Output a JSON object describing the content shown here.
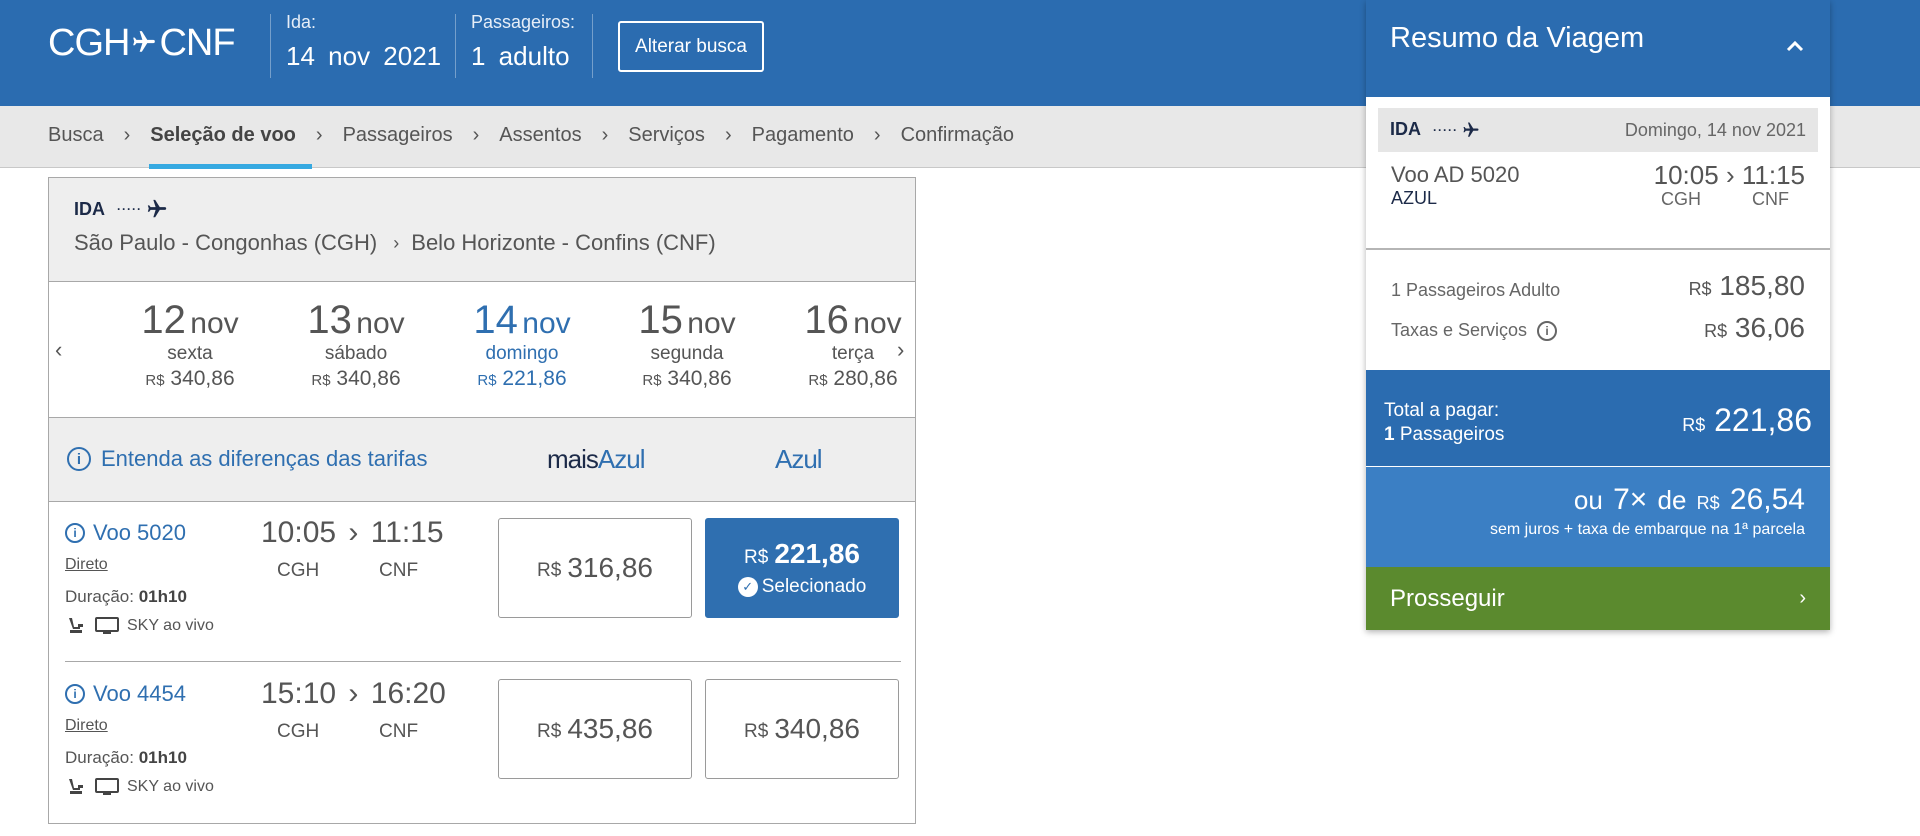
{
  "header": {
    "origin": "CGH",
    "destination": "CNF",
    "ida_label": "Ida:",
    "ida_date": "14  nov  2021",
    "passengers_label": "Passageiros:",
    "passengers_value": "1 adulto",
    "change_search_button": "Alterar busca"
  },
  "breadcrumb": {
    "items": [
      "Busca",
      "Seleção de voo",
      "Passageiros",
      "Assentos",
      "Serviços",
      "Pagamento",
      "Confirmação"
    ],
    "active_index": 1
  },
  "trip": {
    "direction": "IDA",
    "origin_full": "São Paulo - Congonhas (CGH)",
    "destination_full": "Belo Horizonte - Confins (CNF)"
  },
  "currency": "R$",
  "dates": [
    {
      "day": "12",
      "month": "nov",
      "weekday": "sexta",
      "price": "340,86",
      "selected": false
    },
    {
      "day": "13",
      "month": "nov",
      "weekday": "sábado",
      "price": "340,86",
      "selected": false
    },
    {
      "day": "14",
      "month": "nov",
      "weekday": "domingo",
      "price": "221,86",
      "selected": true
    },
    {
      "day": "15",
      "month": "nov",
      "weekday": "segunda",
      "price": "340,86",
      "selected": false
    },
    {
      "day": "16",
      "month": "nov",
      "weekday": "terça",
      "price": "280,86",
      "selected": false
    }
  ],
  "fare_header": {
    "info_link": "Entenda as diferenças das tarifas",
    "brand1_part1": "mais",
    "brand1_part2": "Azul",
    "brand2": "Azul"
  },
  "flights": [
    {
      "name": "Voo 5020",
      "type": "Direto",
      "duration_label": "Duração:",
      "duration": "01h10",
      "amenity": "SKY ao vivo",
      "dep_time": "10:05",
      "arr_time": "11:15",
      "dep_code": "CGH",
      "arr_code": "CNF",
      "fare_mais": "316,86",
      "fare_azul": "221,86",
      "azul_selected": true,
      "selected_label": "Selecionado"
    },
    {
      "name": "Voo 4454",
      "type": "Direto",
      "duration_label": "Duração:",
      "duration": "01h10",
      "amenity": "SKY ao vivo",
      "dep_time": "15:10",
      "arr_time": "16:20",
      "dep_code": "CGH",
      "arr_code": "CNF",
      "fare_mais": "435,86",
      "fare_azul": "340,86",
      "azul_selected": false
    }
  ],
  "summary": {
    "title": "Resumo da Viagem",
    "ida_label": "IDA",
    "ida_date": "Domingo, 14  nov 2021",
    "flight": "Voo  AD 5020",
    "airline": "AZUL",
    "dep_time": "10:05",
    "arr_time": "11:15",
    "dep_code": "CGH",
    "arr_code": "CNF",
    "pax_label": "1 Passageiros Adulto",
    "pax_amount": "185,80",
    "tax_label": "Taxas e Serviços",
    "tax_amount": "36,06",
    "total_label": "Total a pagar:",
    "total_pax_count": "1",
    "total_pax_word": "Passageiros",
    "total_amount": "221,86",
    "installment_prefix": "ou",
    "installment_count": "7×",
    "installment_de": "de",
    "installment_amount": "26,54",
    "installment_note": "sem juros + taxa de embarque na 1ª parcela",
    "cta": "Prosseguir"
  },
  "colors": {
    "primary_blue": "#2b6cb0",
    "link_blue": "#2f6fb0",
    "accent_cyan": "#36a9e1",
    "cta_green": "#5b8a2e",
    "navy": "#1c2a48"
  },
  "icons": [
    "plane-icon",
    "chevron-right-icon",
    "chevron-left-icon",
    "chevron-up-icon",
    "info-icon",
    "check-icon",
    "seat-icon",
    "tv-icon"
  ]
}
